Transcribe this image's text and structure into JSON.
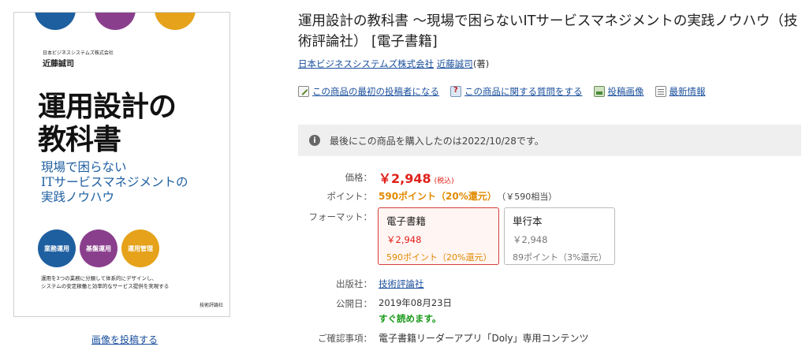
{
  "cover": {
    "publisher_small": "日本ビジネスシステムズ株式会社",
    "author": "近藤誠司",
    "title_line1": "運用設計の",
    "title_line2": "教科書",
    "sub_line1": "現場で困らない",
    "sub_line2": "ITサービスマネジメントの",
    "sub_line3": "実践ノウハウ",
    "circles": [
      "業務運用",
      "基盤運用",
      "運用管理"
    ],
    "blurb_line1": "運用を3つの業務に分類して体系的にデザインし、",
    "blurb_line2": "システムの安定稼働と効率的なサービス提供を実現する",
    "publisher_logo": "技術評論社",
    "colors": {
      "blue": "#1e5fa0",
      "purple": "#8a3f8c",
      "orange": "#e5a21a"
    }
  },
  "post_image_link": "画像を投稿する",
  "product": {
    "title": "運用設計の教科書 ～現場で困らないITサービスマネジメントの実践ノウハウ（技術評論社） [電子書籍]",
    "byline_company": "日本ビジネスシステムズ株式会社",
    "byline_author": "近藤誠司",
    "byline_suffix": "(著)"
  },
  "actions": [
    {
      "label": "この商品の最初の投稿者になる",
      "icon": "pen-icon"
    },
    {
      "label": "この商品に関する質問をする",
      "icon": "question-icon"
    },
    {
      "label": "投稿画像",
      "icon": "image-icon"
    },
    {
      "label": "最新情報",
      "icon": "news-icon"
    }
  ],
  "notice": "最後にこの商品を購入したのは2022/10/28です。",
  "labels": {
    "price": "価格：",
    "points": "ポイント：",
    "format": "フォーマット：",
    "publisher": "出版社：",
    "release": "公開日：",
    "confirm": "ご確認事項："
  },
  "price": {
    "value": "￥2,948",
    "tax": "(税込)"
  },
  "points": {
    "value": "590ポイント（20%還元）",
    "equiv": "（￥590相当）"
  },
  "formats": [
    {
      "name": "電子書籍",
      "price": "￥2,948",
      "points": "590ポイント（20%還元）",
      "selected": true
    },
    {
      "name": "単行本",
      "price": "￥2,948",
      "points": "89ポイント（3%還元）",
      "selected": false
    }
  ],
  "publisher": "技術評論社",
  "release_date": "2019年08月23日",
  "availability": "すぐ読めます。",
  "confirm": "電子書籍リーダーアプリ「Doly」専用コンテンツ"
}
